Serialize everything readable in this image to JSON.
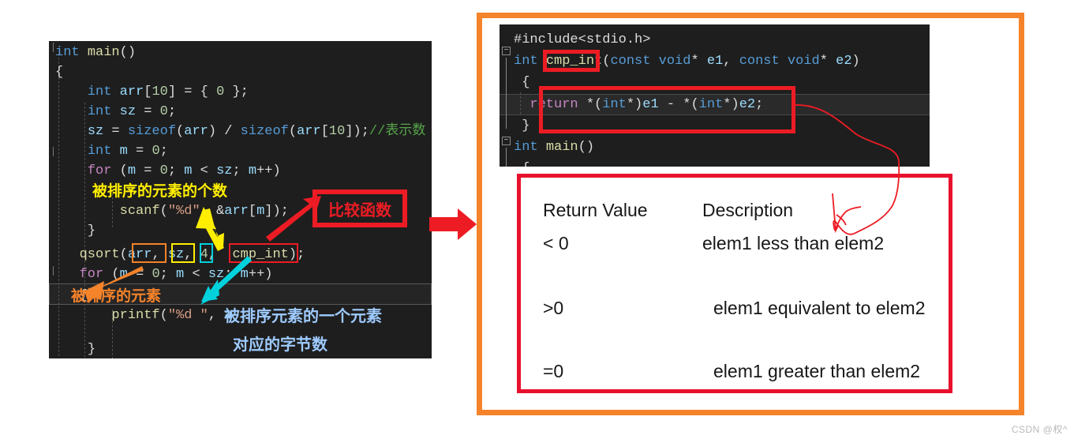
{
  "left_panel": {
    "lines": [
      {
        "id": "l1",
        "text": "int main()"
      },
      {
        "id": "l2",
        "text": "{"
      },
      {
        "id": "l3",
        "text": "    int arr[10] = { 0 };"
      },
      {
        "id": "l4",
        "text": "    int sz = 0;"
      },
      {
        "id": "l5",
        "text": "    sz = sizeof(arr) / sizeof(arr[10]);//表示数"
      },
      {
        "id": "l6",
        "text": "    int m = 0;"
      },
      {
        "id": "l7",
        "text": "    for (m = 0; m < sz; m++)"
      },
      {
        "id": "l8",
        "text": "        scanf(\"%d\", &arr[m]);"
      },
      {
        "id": "l9",
        "text": "    }"
      },
      {
        "id": "l10",
        "text": "    qsort(arr, sz, 4,  cmp_int);"
      },
      {
        "id": "l11",
        "text": "    for (m = 0; m < sz; m++)"
      },
      {
        "id": "l12",
        "text": "    {"
      },
      {
        "id": "l13",
        "text": "        printf(\"%d \", a"
      },
      {
        "id": "l14",
        "text": "    }"
      }
    ],
    "annotations": {
      "count_note": "被排序的元素的个数",
      "element_note": "被排序的元素",
      "one_element_note": "被排序元素的一个元素",
      "bytes_note": "对应的字节数",
      "compare_fn_box": "比较函数"
    },
    "boxed_tokens": {
      "arr": "arr",
      "sz": "sz",
      "four": "4",
      "cmp_int": "cmp_int"
    }
  },
  "right_panel": {
    "code_lines": [
      {
        "id": "r1",
        "text": "#include<stdio.h>"
      },
      {
        "id": "r2",
        "text": "int cmp_int(const void* e1, const void* e2)"
      },
      {
        "id": "r3",
        "text": "{"
      },
      {
        "id": "r4",
        "text": "    return *(int*)e1 - *(int*)e2;"
      },
      {
        "id": "r5",
        "text": "}"
      },
      {
        "id": "r6",
        "text": "int main()"
      },
      {
        "id": "r7",
        "text": "{"
      }
    ],
    "highlight_function_name": "cmp_int",
    "highlight_return_stmt": "return *(int*)e1 - *(int*)e2;"
  },
  "return_table": {
    "headers": [
      "Return Value",
      "Description"
    ],
    "rows": [
      {
        "value": "< 0",
        "description": "elem1 less than elem2"
      },
      {
        "value": ">0",
        "description": "elem1 equivalent to elem2"
      },
      {
        "value": "=0",
        "description": "elem1 greater than elem2"
      }
    ]
  },
  "colors": {
    "orange_frame": "#f5832a",
    "red_box": "#ed1c24",
    "table_red": "#e8112d",
    "yellow_arrow": "#ffee00",
    "cyan_arrow": "#00d2dd",
    "orange_arrow": "#f5832a",
    "editor_bg": "#1e1e1e",
    "annotation_yellow": "#ffee00",
    "annotation_orange": "#f5832a",
    "annotation_cyan": "#9ecbff"
  },
  "watermark": {
    "text": "CSDN @权^"
  },
  "icons": {
    "fold_collapse": "−",
    "transition_arrow": "right-arrow-icon"
  }
}
